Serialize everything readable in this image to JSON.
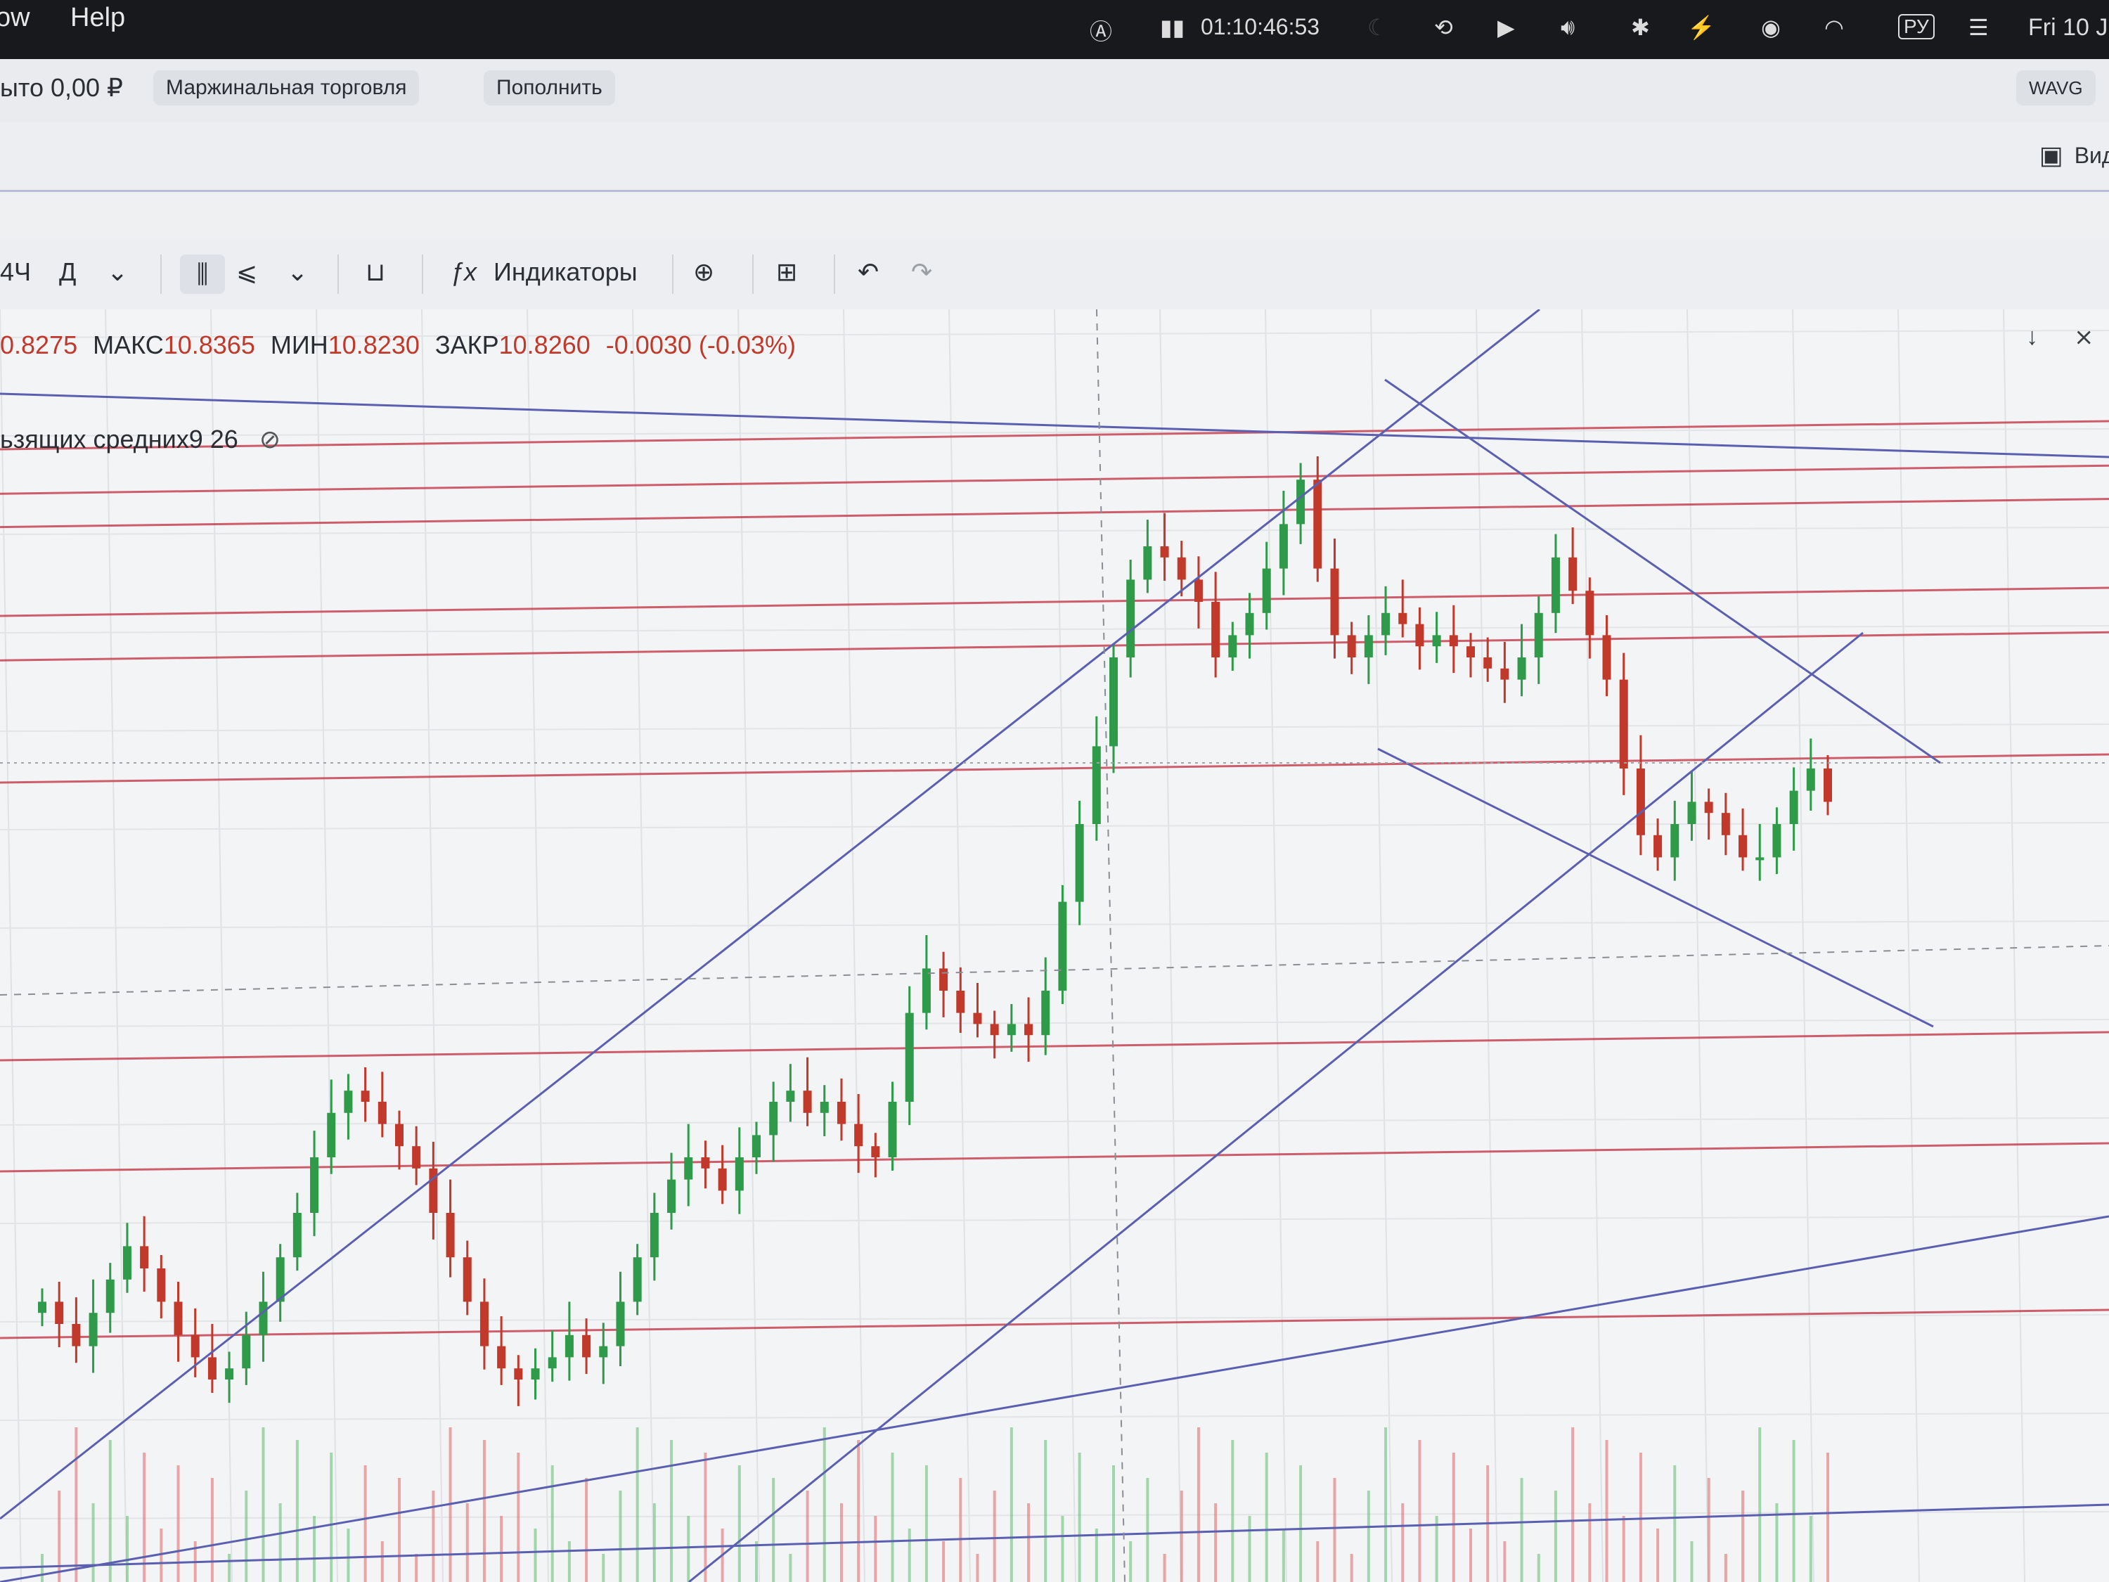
{
  "menubar": {
    "items": [
      "ow",
      "Help"
    ],
    "clock": "01:10:46:53",
    "input_source": "РУ",
    "date": "Fri 10 J"
  },
  "topbar": {
    "balance": "ыто 0,00 ₽",
    "margin_button": "Маржинальная торговля",
    "topup_button": "Пополнить",
    "wavg_badge": "WAVG"
  },
  "panel": {
    "widgets_button": "Видж"
  },
  "toolbar": {
    "interval_4h": "4Ч",
    "interval_day": "Д",
    "indicators_label": "Индикаторы"
  },
  "ohlc": {
    "open_value": "0.8275",
    "high_label": "МАКС",
    "high_value": "10.8365",
    "low_label": "МИН",
    "low_value": "10.8230",
    "close_label": "ЗАКР",
    "close_value": "10.8260",
    "change": "-0.0030 (-0.03%)"
  },
  "indicator": {
    "ma_label": "ьзящих средних9 26"
  },
  "chart_data": {
    "type": "candlestick",
    "title": "",
    "xlabel": "",
    "ylabel": "",
    "grid": true,
    "colors": {
      "up": "#2e9a4a",
      "down": "#c0392b",
      "trendline": "#5a5fb0",
      "level": "#c5384a",
      "volume_up": "#6cc07a",
      "volume_down": "#e07070"
    },
    "price_range": [
      9.95,
      10.95
    ],
    "horizontal_levels": [
      10.9,
      10.86,
      10.83,
      10.75,
      10.71,
      10.6,
      10.35,
      10.25,
      10.1
    ],
    "series": [
      {
        "values": [
          10.12,
          10.1,
          10.08,
          10.11,
          10.14,
          10.17,
          10.15,
          10.12,
          10.09,
          10.07,
          10.05,
          10.06,
          10.09,
          10.12,
          10.16,
          10.2,
          10.25,
          10.29,
          10.31,
          10.3,
          10.28,
          10.26,
          10.24,
          10.2,
          10.16,
          10.12,
          10.08,
          10.06,
          10.05,
          10.06,
          10.07,
          10.09,
          10.07,
          10.08,
          10.12,
          10.16,
          10.2,
          10.23,
          10.25,
          10.24,
          10.22,
          10.25,
          10.27,
          10.3,
          10.31,
          10.29,
          10.3,
          10.28,
          10.26,
          10.25,
          10.3,
          10.38,
          10.42,
          10.4,
          10.38,
          10.37,
          10.36,
          10.37,
          10.36,
          10.4,
          10.48,
          10.55,
          10.62,
          10.7,
          10.77,
          10.8,
          10.79,
          10.77,
          10.75,
          10.7,
          10.72,
          10.74,
          10.78,
          10.82,
          10.86,
          10.78,
          10.72,
          10.7,
          10.72,
          10.74,
          10.73,
          10.71,
          10.72,
          10.71,
          10.7,
          10.69,
          10.68,
          10.7,
          10.74,
          10.79,
          10.76,
          10.72,
          10.68,
          10.6,
          10.54,
          10.52,
          10.55,
          10.57,
          10.56,
          10.54,
          10.52,
          10.52,
          10.55,
          10.58,
          10.6,
          10.57
        ]
      }
    ]
  }
}
